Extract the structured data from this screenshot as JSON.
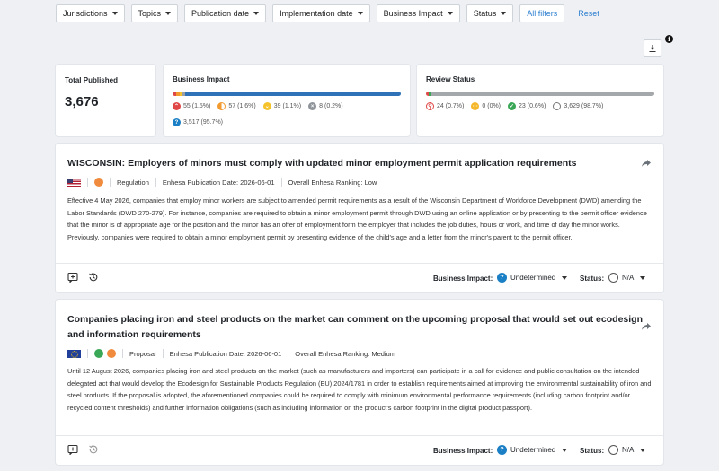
{
  "filters": {
    "jurisdictions": "Jurisdictions",
    "topics": "Topics",
    "publication_date": "Publication date",
    "implementation_date": "Implementation date",
    "business_impact": "Business Impact",
    "status": "Status",
    "all_filters": "All filters",
    "reset": "Reset"
  },
  "summary": {
    "total": {
      "title": "Total Published",
      "value": "3,676"
    },
    "business_impact": {
      "title": "Business Impact",
      "segments": [
        {
          "name": "high",
          "fraction": 0.015,
          "color": "#e04848"
        },
        {
          "name": "medium",
          "fraction": 0.016,
          "color": "#f29a2e"
        },
        {
          "name": "low",
          "fraction": 0.011,
          "color": "#f5c32c"
        },
        {
          "name": "none",
          "fraction": 0.002,
          "color": "#9aa0a6"
        },
        {
          "name": "undetermined",
          "fraction": 0.957,
          "color": "#2f72b8"
        }
      ],
      "legend": [
        {
          "count": "55",
          "pct": "(1.5%)"
        },
        {
          "count": "57",
          "pct": "(1.6%)"
        },
        {
          "count": "39",
          "pct": "(1.1%)"
        },
        {
          "count": "8",
          "pct": "(0.2%)"
        },
        {
          "count": "3,517",
          "pct": "(95.7%)"
        }
      ]
    },
    "review_status": {
      "title": "Review Status",
      "segments": [
        {
          "name": "in-review",
          "fraction": 0.007,
          "color": "#e04848"
        },
        {
          "name": "reviewed",
          "fraction": 0.006,
          "color": "#3aa757"
        },
        {
          "name": "not-reviewed",
          "fraction": 0.987,
          "color": "#a5a8ab"
        }
      ],
      "legend": [
        {
          "count": "24",
          "pct": "(0.7%)"
        },
        {
          "count": "0",
          "pct": "(0%)"
        },
        {
          "count": "23",
          "pct": "(0.6%)"
        },
        {
          "count": "3,629",
          "pct": "(98.7%)"
        }
      ]
    }
  },
  "articles": [
    {
      "title": "WISCONSIN: Employers of minors must comply with updated minor employment permit application requirements",
      "type": "Regulation",
      "pub_date": "Enhesa Publication Date: 2026-06-01",
      "ranking": "Overall Enhesa Ranking: Low",
      "body": "Effective 4 May 2026, companies that employ minor workers are subject to amended permit requirements as a result of the Wisconsin Department of Workforce Development (DWD) amending the Labor Standards (DWD 270-279). For instance, companies are required to obtain a minor employment permit through DWD using an online application or by presenting to the permit officer evidence that the minor is of appropriate age for the position and the minor has an offer of employment form the employer that includes the job duties, hours or work, and time of day the minor works. Previously, companies were required to obtain a minor employment permit by presenting evidence of the child's age and a letter from the minor's parent to the permit officer.",
      "bi_label": "Business Impact:",
      "bi_value": "Undetermined",
      "status_label": "Status:",
      "status_value": "N/A"
    },
    {
      "title": "Companies placing iron and steel products on the market can comment on the upcoming proposal that would set out ecodesign and information requirements",
      "type": "Proposal",
      "pub_date": "Enhesa Publication Date: 2026-06-01",
      "ranking": "Overall Enhesa Ranking: Medium",
      "body": "Until 12 August 2026, companies placing iron and steel products on the market (such as manufacturers and importers) can participate in a call for evidence and public consultation on the intended delegated act that would develop the Ecodesign for Sustainable Products Regulation (EU) 2024/1781 in order to establish requirements aimed at improving the environmental sustainability of iron and steel products. If the proposal is adopted, the aforementioned companies could be required to comply with minimum environmental performance requirements (including carbon footprint and/or recycled content thresholds) and further information obligations (such as including information on the product's carbon footprint in the digital product passport).",
      "bi_label": "Business Impact:",
      "bi_value": "Undetermined",
      "status_label": "Status:",
      "status_value": "N/A"
    }
  ]
}
